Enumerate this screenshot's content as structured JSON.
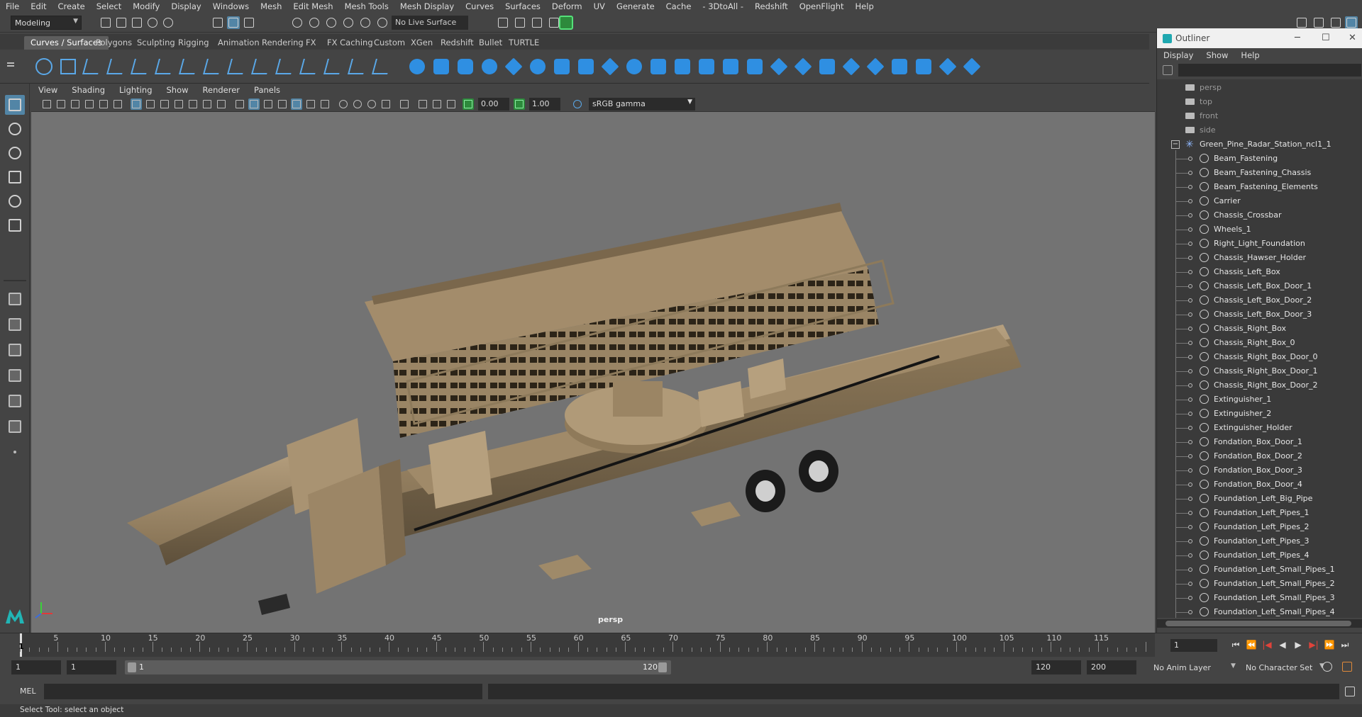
{
  "menubar": [
    "File",
    "Edit",
    "Create",
    "Select",
    "Modify",
    "Display",
    "Windows",
    "Mesh",
    "Edit Mesh",
    "Mesh Tools",
    "Mesh Display",
    "Curves",
    "Surfaces",
    "Deform",
    "UV",
    "Generate",
    "Cache",
    "- 3DtoAll -",
    "Redshift",
    "OpenFlight",
    "Help"
  ],
  "statusline": {
    "mode": "Modeling",
    "live_surface": "No Live Surface"
  },
  "shelf_tabs": [
    "Curves / Surfaces",
    "Polygons",
    "Sculpting",
    "Rigging",
    "Animation",
    "Rendering",
    "FX",
    "FX Caching",
    "Custom",
    "XGen",
    "Redshift",
    "Bullet",
    "TURTLE"
  ],
  "panel_menu": [
    "View",
    "Shading",
    "Lighting",
    "Show",
    "Renderer",
    "Panels"
  ],
  "viewport_toolbar": {
    "exposure": "0.00",
    "gamma": "1.00",
    "color_space": "sRGB gamma"
  },
  "viewport": {
    "camera_label": "persp"
  },
  "outliner": {
    "title": "Outliner",
    "menu": [
      "Display",
      "Show",
      "Help"
    ],
    "cameras": [
      "persp",
      "top",
      "front",
      "side"
    ],
    "group": "Green_Pine_Radar_Station_ncl1_1",
    "items": [
      "Beam_Fastening",
      "Beam_Fastening_Chassis",
      "Beam_Fastening_Elements",
      "Carrier",
      "Chassis_Crossbar",
      "Wheels_1",
      "Right_Light_Foundation",
      "Chassis_Hawser_Holder",
      "Chassis_Left_Box",
      "Chassis_Left_Box_Door_1",
      "Chassis_Left_Box_Door_2",
      "Chassis_Left_Box_Door_3",
      "Chassis_Right_Box",
      "Chassis_Right_Box_0",
      "Chassis_Right_Box_Door_0",
      "Chassis_Right_Box_Door_1",
      "Chassis_Right_Box_Door_2",
      "Extinguisher_1",
      "Extinguisher_2",
      "Extinguisher_Holder",
      "Fondation_Box_Door_1",
      "Fondation_Box_Door_2",
      "Fondation_Box_Door_3",
      "Fondation_Box_Door_4",
      "Foundation_Left_Big_Pipe",
      "Foundation_Left_Pipes_1",
      "Foundation_Left_Pipes_2",
      "Foundation_Left_Pipes_3",
      "Foundation_Left_Pipes_4",
      "Foundation_Left_Small_Pipes_1",
      "Foundation_Left_Small_Pipes_2",
      "Foundation_Left_Small_Pipes_3",
      "Foundation_Left_Small_Pipes_4"
    ]
  },
  "timeline": {
    "ticks": [
      "5",
      "10",
      "15",
      "20",
      "25",
      "30",
      "35",
      "40",
      "45",
      "50",
      "55",
      "60",
      "65",
      "70",
      "75",
      "80",
      "85",
      "90",
      "95",
      "100",
      "105",
      "110",
      "115"
    ],
    "current_frame": "1",
    "frame_field": "1"
  },
  "range": {
    "start": "1",
    "start_inner": "1",
    "slider_start": "1",
    "slider_end": "120",
    "end_inner": "120",
    "end": "200",
    "anim_layer": "No Anim Layer",
    "character_set": "No Character Set"
  },
  "cmdline": {
    "lang": "MEL"
  },
  "helpline": "Select Tool: select an object"
}
